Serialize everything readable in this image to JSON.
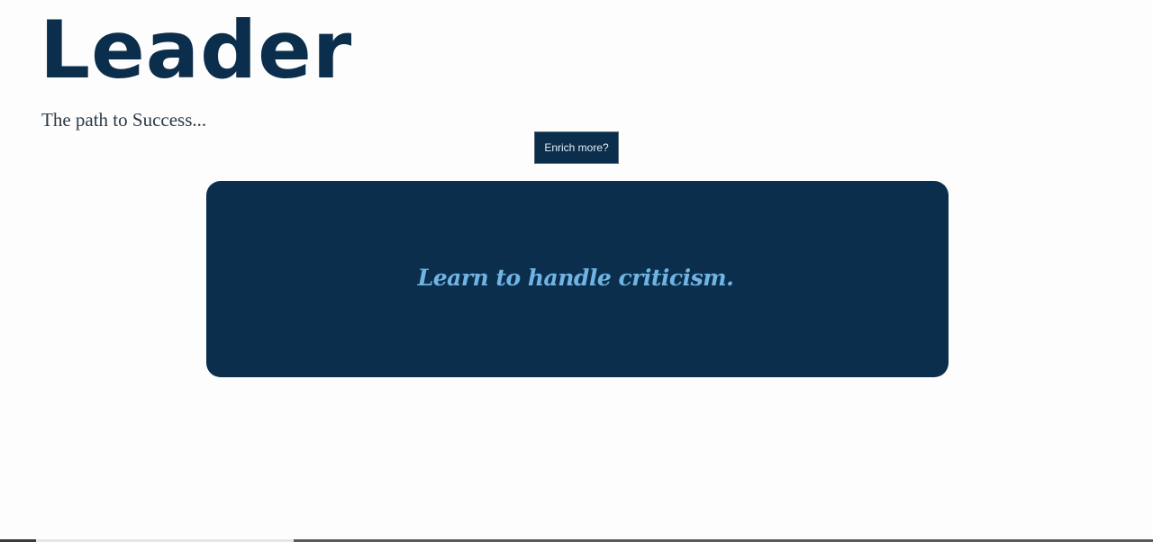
{
  "header": {
    "title": "Leader",
    "tagline": "The path to Success..."
  },
  "actions": {
    "enrich_label": "Enrich more?"
  },
  "quote": {
    "text": "Learn to handle criticism."
  },
  "colors": {
    "primary": "#0b2e4d",
    "quote_text": "#6fb4e2",
    "background": "#fdfdfd"
  }
}
